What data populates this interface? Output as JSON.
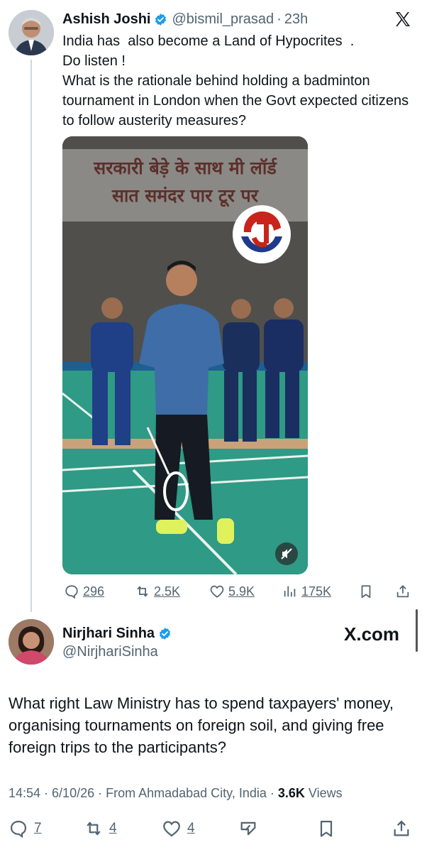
{
  "tweet1": {
    "author": "Ashish Joshi",
    "handle": "@bismil_prasad",
    "separator": "·",
    "time": "23h",
    "lines": [
      "India has  also become a Land of Hypocrites  .",
      "Do listen !",
      "What is the rationale behind holding a badminton tournament in London when the Govt expected citizens to follow austerity measures?"
    ],
    "media": {
      "overlay_line1": "सरकारी बेड़े के साथ मी लॉर्ड",
      "overlay_line2": "सात समंदर पार टूर पर"
    },
    "stats": {
      "replies": "296",
      "reposts": "2.5K",
      "likes": "5.9K",
      "views": "175K"
    }
  },
  "tweet2": {
    "author": "Nirjhari Sinha",
    "handle": "@NirjhariSinha",
    "brand": "X.com",
    "text": "What right Law Ministry has to spend taxpayers' money, organising tournaments on foreign soil, and giving free foreign trips to the participants?",
    "meta": {
      "time_date": "14:54 · 6/10/26 · From Ahmadabad City, India · ",
      "views_count": "3.6K",
      "views_label": " Views"
    },
    "stats": {
      "replies": "7",
      "reposts": "4",
      "likes": "4"
    }
  },
  "colors": {
    "verified": "#1d9bf0",
    "secondary_text": "#536471",
    "primary_text": "#0f1419",
    "court": "#2f9a85"
  },
  "icons": [
    "verified-badge-icon",
    "x-logo-icon",
    "reply-icon",
    "repost-icon",
    "like-icon",
    "views-icon",
    "bookmark-icon",
    "share-icon",
    "grok-icon",
    "mute-icon"
  ]
}
